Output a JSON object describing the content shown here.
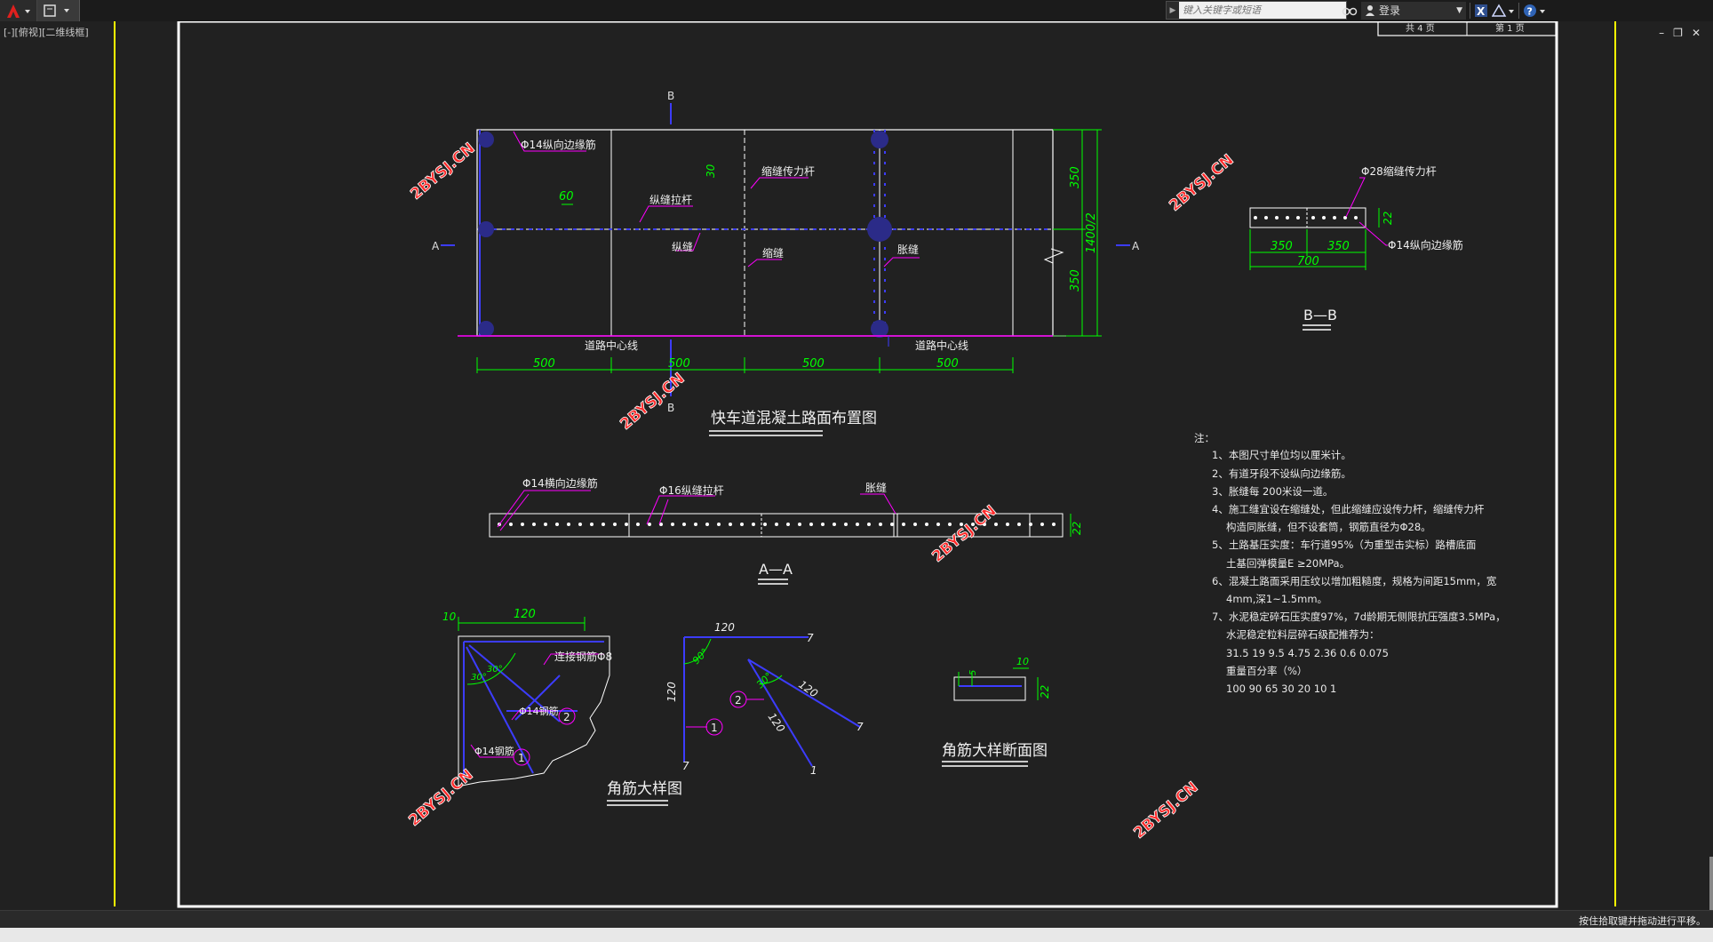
{
  "title_bar": {
    "search_placeholder": "键入关键字或短语",
    "signin_label": "登录"
  },
  "viewport": {
    "label": "[-][俯视][二维线框]",
    "status_message": "按住拾取键并拖动进行平移。"
  },
  "sheet": {
    "sheet_total": "共 4 页",
    "sheet_index": "第 1 页",
    "watermark": "2BYSJ.CN"
  },
  "plan": {
    "title": "快车道混凝土路面布置图",
    "label_b": "B",
    "label_a": "A",
    "rebar_long_edge": "Φ14纵向边缘筋",
    "tie_bar": "纵缝拉杆",
    "dowel_bar": "缩缝传力杆",
    "longitudinal_joint": "纵缝",
    "contraction_joint": "缩缝",
    "expansion_joint": "胀缝",
    "road_centerline": "道路中心线",
    "dim_60": "60",
    "dim_30": "30",
    "dim_350": "350",
    "dim_1400_2": "1400/2",
    "dim_500": "500"
  },
  "section_bb": {
    "title": "B—B",
    "dowel": "Φ28缩缝传力杆",
    "edge_rebar": "Φ14纵向边缘筋",
    "dim_350": "350",
    "dim_700": "700",
    "dim_22": "22"
  },
  "section_aa": {
    "title": "A—A",
    "edge_rebar": "Φ14横向边缘筋",
    "tie_bar": "Φ16纵缝拉杆",
    "expansion_joint": "胀缝",
    "dim_22": "22"
  },
  "corner_detail": {
    "title": "角筋大样图",
    "dim_10": "10",
    "dim_120": "120",
    "dim_30": "30°",
    "connect_rebar": "连接钢筋Φ8",
    "rebar_2": "Φ14钢筋",
    "rebar_1": "Φ14钢筋",
    "num_1": "1",
    "num_2": "2"
  },
  "corner_geometry": {
    "dim_120": "120",
    "dim_7": "7",
    "dim_1": "1",
    "angle_90": "90°",
    "angle_30": "30°",
    "num_1": "1",
    "num_2": "2"
  },
  "corner_section": {
    "title": "角筋大样断面图",
    "dim_5": "5",
    "dim_10": "10",
    "dim_22": "22"
  },
  "notes": {
    "heading": "注：",
    "lines": [
      "1、本图尺寸单位均以厘米计。",
      "2、有道牙段不设纵向边缘筋。",
      "3、胀缝每 200米设一道。",
      "4、施工缝宜设在缩缝处，但此缩缝应设传力杆，缩缝传力杆",
      "构造同胀缝，但不设套筒，钢筋直径为Φ28。",
      "5、土路基压实度：车行道95%（为重型击实标）路槽底面",
      "土基回弹模量E ≥20MPa。",
      "6、混凝土路面采用压纹以增加粗糙度，规格为间距15mm，宽",
      "4mm,深1~1.5mm。",
      "7、水泥稳定碎石压实度97%，7d龄期无侧限抗压强度3.5MPa，",
      "水泥稳定粒料层碎石级配推荐为：",
      "31.5   19   9.5   4.75   2.36   0.6   0.075",
      "重量百分率（%）",
      "100    90   65    30    20    10    1"
    ]
  },
  "colors": {
    "background": "#212121",
    "frame": "#ffffff",
    "boundary_yellow": "#ffff00",
    "dimension": "#00ff00",
    "rebar_blue": "#3c3cff",
    "leader_magenta": "#ff00ff",
    "watermark_red": "#ff2a2a"
  }
}
